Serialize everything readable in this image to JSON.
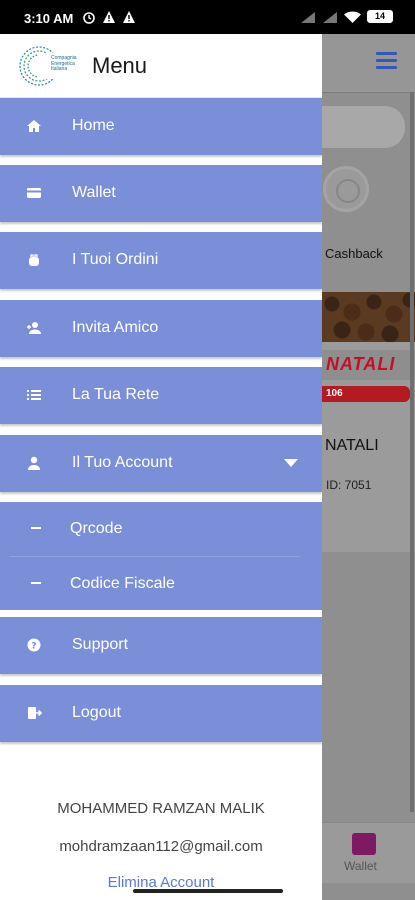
{
  "status_bar": {
    "time": "3:10 AM",
    "battery": "14"
  },
  "background": {
    "cashback_label": "Cashback",
    "store_logo_text": "NATALI",
    "store_red_text": "106",
    "store_name": "NATALI",
    "store_id": "ID: 7051",
    "bottom_tab_label": "Wallet"
  },
  "drawer": {
    "logo_text": "Compagnia Energetica Italiana",
    "title": "Menu",
    "items": [
      {
        "label": "Home",
        "icon": "home-icon"
      },
      {
        "label": "Wallet",
        "icon": "card-icon"
      },
      {
        "label": "I Tuoi Ordini",
        "icon": "cart-icon"
      },
      {
        "label": "Invita Amico",
        "icon": "add-person-icon"
      },
      {
        "label": "La Tua Rete",
        "icon": "list-icon"
      },
      {
        "label": "Il Tuo Account",
        "icon": "person-icon"
      }
    ],
    "sub_items": [
      {
        "label": "Qrcode"
      },
      {
        "label": "Codice Fiscale"
      }
    ],
    "bottom_items": [
      {
        "label": "Support",
        "icon": "help-icon"
      },
      {
        "label": "Logout",
        "icon": "logout-icon"
      }
    ],
    "user_name": "MOHAMMED RAMZAN MALIK",
    "user_email": "mohdramzaan112@gmail.com",
    "delete_account": "Elimina Account"
  },
  "colors": {
    "menu_item_bg": "#7a8fd8",
    "accent": "#3557b8"
  }
}
